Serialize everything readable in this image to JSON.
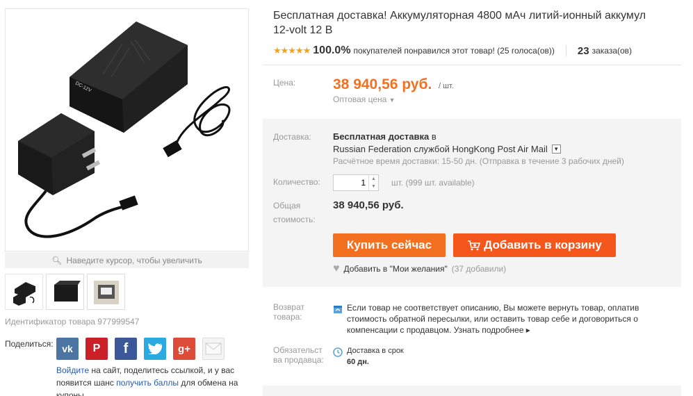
{
  "product": {
    "title_line1": "Бесплатная доставка! Аккумуляторная 4800 мАч литий-ионный аккумул",
    "title_line2": "12-volt 12 В",
    "stars": "★★★★★",
    "rating_pct": "100.0%",
    "rating_text": "покупателей понравился этот товар! (25 голоса(ов))",
    "orders_count": "23",
    "orders_label": "заказа(ов)",
    "id_text": "Идентификатор товара 977999547",
    "zoom_hint": "Наведите курсор, чтобы увеличить",
    "device_label": "DC-12V"
  },
  "price": {
    "label": "Цена:",
    "value": "38 940,56 руб.",
    "per_unit": "/ шт.",
    "wholesale": "Оптовая цена"
  },
  "shipping": {
    "label": "Доставка:",
    "free": "Бесплатная доставка",
    "in": "в",
    "method": "Russian Federation службой HongKong Post Air Mail",
    "time": "Расчётное время доставки: 15-50 дн. (Отправка в течение 3 рабочих дней)"
  },
  "quantity": {
    "label": "Количество:",
    "value": "1",
    "unit_note": "шт. (999 шт. available)"
  },
  "total": {
    "label_1": "Общая",
    "label_2": "стоимость:",
    "value": "38 940,56 руб."
  },
  "actions": {
    "buy_now": "Купить сейчас",
    "add_to_cart": "Добавить в корзину",
    "wishlist": "Добавить в \"Мои желания\"",
    "wishlist_count": "(37 добавили)"
  },
  "returns": {
    "label_1": "Возврат",
    "label_2": "товара:",
    "text": "Если товар не соответствует описанию, Вы можете вернуть товар, оплатив стоимость обратной пересылки, или оставить товар себе и договориться о компенсации с продавцом.",
    "more": "Узнать подробнее ▸"
  },
  "protection": {
    "label_1": "Обязательст",
    "label_2": "ва продавца:",
    "line1": "Доставка в срок",
    "line2": "60 дн."
  },
  "share": {
    "label": "Поделиться:",
    "login_link": "Войдите",
    "note_1": " на сайт, поделитесь ссылкой, и у вас появится шанс ",
    "points_link": "получить баллы",
    "note_2": " для обмена на купоны"
  },
  "colors": {
    "accent": "#f37021",
    "cart": "#f5561b",
    "link": "#2a5ca8"
  }
}
